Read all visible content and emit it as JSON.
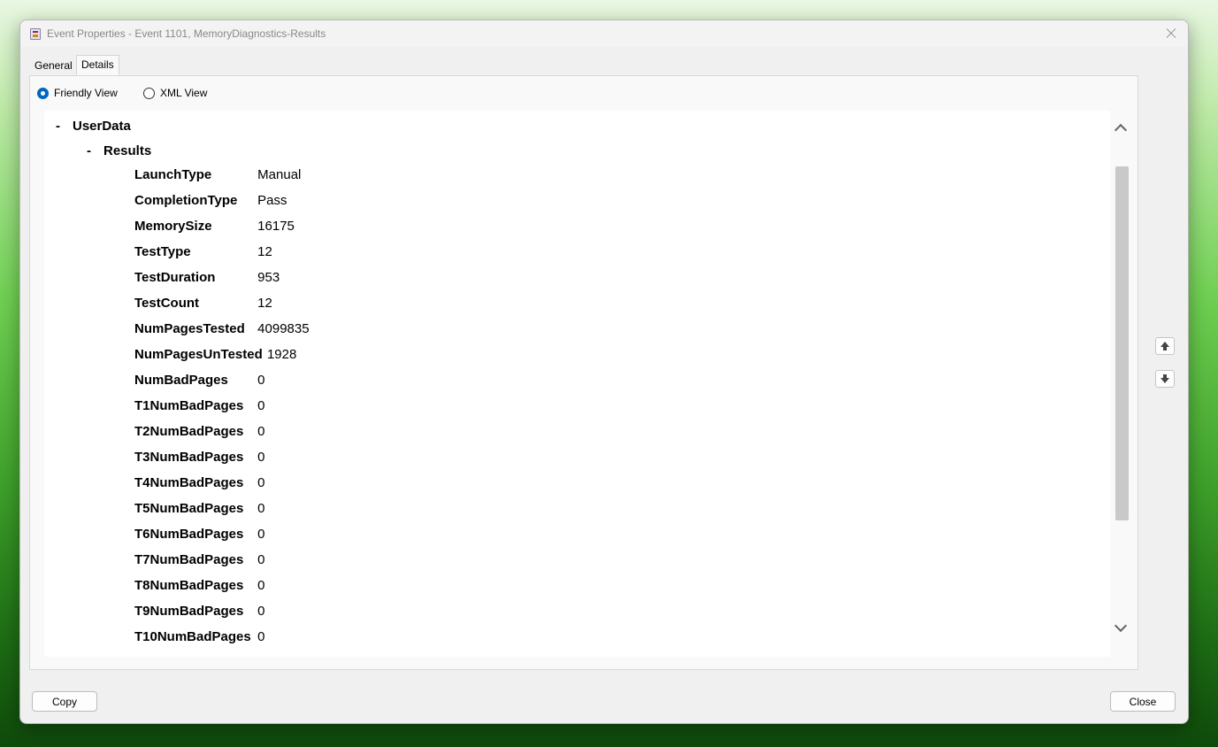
{
  "window": {
    "title": "Event Properties - Event 1101, MemoryDiagnostics-Results",
    "icon": "event-viewer-icon"
  },
  "tabs": [
    {
      "label": "General",
      "selected": false
    },
    {
      "label": "Details",
      "selected": true
    }
  ],
  "view_options": {
    "friendly_label": "Friendly View",
    "xml_label": "XML View",
    "selected": "Friendly View"
  },
  "tree": {
    "root_label": "UserData",
    "root_toggle": "-",
    "child_label": "Results",
    "child_toggle": "-",
    "fields": [
      {
        "name": "LaunchType",
        "value": "Manual"
      },
      {
        "name": "CompletionType",
        "value": "Pass"
      },
      {
        "name": "MemorySize",
        "value": "16175"
      },
      {
        "name": "TestType",
        "value": "12"
      },
      {
        "name": "TestDuration",
        "value": "953"
      },
      {
        "name": "TestCount",
        "value": "12"
      },
      {
        "name": "NumPagesTested",
        "value": "4099835"
      },
      {
        "name": "NumPagesUnTested",
        "value": "1928"
      },
      {
        "name": "NumBadPages",
        "value": "0"
      },
      {
        "name": "T1NumBadPages",
        "value": "0"
      },
      {
        "name": "T2NumBadPages",
        "value": "0"
      },
      {
        "name": "T3NumBadPages",
        "value": "0"
      },
      {
        "name": "T4NumBadPages",
        "value": "0"
      },
      {
        "name": "T5NumBadPages",
        "value": "0"
      },
      {
        "name": "T6NumBadPages",
        "value": "0"
      },
      {
        "name": "T7NumBadPages",
        "value": "0"
      },
      {
        "name": "T8NumBadPages",
        "value": "0"
      },
      {
        "name": "T9NumBadPages",
        "value": "0"
      },
      {
        "name": "T10NumBadPages",
        "value": "0"
      }
    ]
  },
  "buttons": {
    "copy_label": "Copy",
    "close_label": "Close"
  },
  "colors": {
    "accent": "#0067c0",
    "window_bg": "#f0f0f0",
    "content_bg": "#ffffff"
  }
}
